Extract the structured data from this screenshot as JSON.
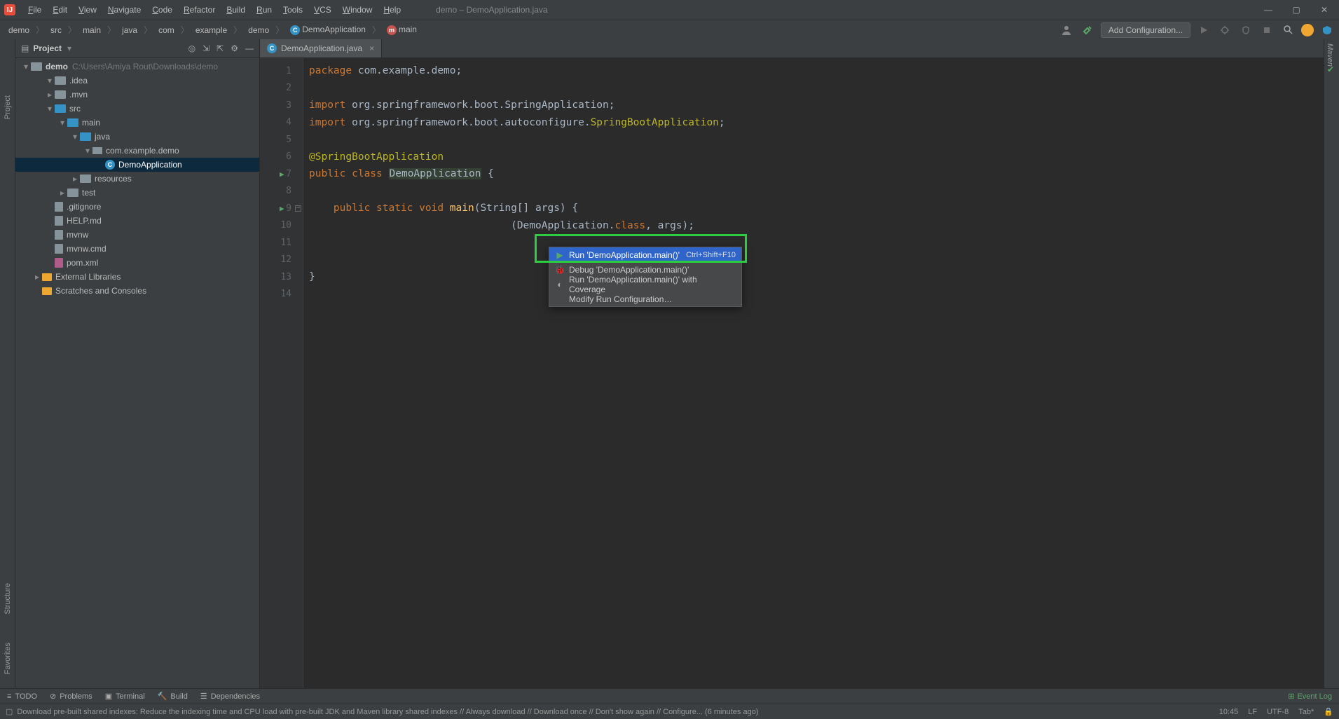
{
  "window": {
    "title": "demo – DemoApplication.java"
  },
  "menu": [
    "File",
    "Edit",
    "View",
    "Navigate",
    "Code",
    "Refactor",
    "Build",
    "Run",
    "Tools",
    "VCS",
    "Window",
    "Help"
  ],
  "breadcrumb": [
    "demo",
    "src",
    "main",
    "java",
    "com",
    "example",
    "demo",
    "DemoApplication",
    "main"
  ],
  "toolbar": {
    "config_label": "Add Configuration..."
  },
  "project_panel": {
    "title": "Project",
    "root": {
      "name": "demo",
      "path": "C:\\Users\\Amiya Rout\\Downloads\\demo"
    },
    "items": [
      {
        "depth": 1,
        "arrow": "down",
        "icon": "folder",
        "name": ".idea"
      },
      {
        "depth": 1,
        "arrow": "right",
        "icon": "folder",
        "name": ".mvn"
      },
      {
        "depth": 1,
        "arrow": "down",
        "icon": "folder-blue",
        "name": "src"
      },
      {
        "depth": 2,
        "arrow": "down",
        "icon": "folder-blue",
        "name": "main"
      },
      {
        "depth": 3,
        "arrow": "down",
        "icon": "folder-blue",
        "name": "java"
      },
      {
        "depth": 4,
        "arrow": "down",
        "icon": "pkg",
        "name": "com.example.demo"
      },
      {
        "depth": 5,
        "arrow": "",
        "icon": "java",
        "name": "DemoApplication",
        "selected": true
      },
      {
        "depth": 3,
        "arrow": "right",
        "icon": "folder",
        "name": "resources"
      },
      {
        "depth": 2,
        "arrow": "right",
        "icon": "folder",
        "name": "test"
      },
      {
        "depth": 1,
        "arrow": "",
        "icon": "file",
        "name": ".gitignore"
      },
      {
        "depth": 1,
        "arrow": "",
        "icon": "file",
        "name": "HELP.md"
      },
      {
        "depth": 1,
        "arrow": "",
        "icon": "file",
        "name": "mvnw"
      },
      {
        "depth": 1,
        "arrow": "",
        "icon": "file",
        "name": "mvnw.cmd"
      },
      {
        "depth": 1,
        "arrow": "",
        "icon": "file-m",
        "name": "pom.xml"
      },
      {
        "depth": 0,
        "arrow": "right",
        "icon": "lib",
        "name": "External Libraries"
      },
      {
        "depth": 0,
        "arrow": "",
        "icon": "lib",
        "name": "Scratches and Consoles"
      }
    ]
  },
  "tabs": [
    {
      "icon": "java",
      "label": "DemoApplication.java"
    }
  ],
  "code_lines": [
    {
      "n": 1,
      "tokens": [
        {
          "t": "package ",
          "c": "k"
        },
        {
          "t": "com.example.demo",
          "c": "pkg"
        },
        {
          "t": ";",
          "c": "s"
        }
      ]
    },
    {
      "n": 2,
      "tokens": []
    },
    {
      "n": 3,
      "tokens": [
        {
          "t": "import ",
          "c": "k"
        },
        {
          "t": "org.springframework.boot.SpringApplication",
          "c": "cls"
        },
        {
          "t": ";",
          "c": "s"
        }
      ]
    },
    {
      "n": 4,
      "tokens": [
        {
          "t": "import ",
          "c": "k"
        },
        {
          "t": "org.springframework.boot.autoconfigure.",
          "c": "cls"
        },
        {
          "t": "SpringBootApplication",
          "c": "an"
        },
        {
          "t": ";",
          "c": "s"
        }
      ]
    },
    {
      "n": 5,
      "tokens": []
    },
    {
      "n": 6,
      "tokens": [
        {
          "t": "@SpringBootApplication",
          "c": "an"
        }
      ]
    },
    {
      "n": 7,
      "run": true,
      "tokens": [
        {
          "t": "public class ",
          "c": "k"
        },
        {
          "t": "DemoApplication",
          "c": "c-name"
        },
        {
          "t": " {",
          "c": "s"
        }
      ]
    },
    {
      "n": 8,
      "tokens": []
    },
    {
      "n": 9,
      "run": true,
      "fold": true,
      "tokens": [
        {
          "t": "    ",
          "c": "s"
        },
        {
          "t": "public static void ",
          "c": "k"
        },
        {
          "t": "main",
          "c": "fn"
        },
        {
          "t": "(String[] args) {",
          "c": "s"
        }
      ]
    },
    {
      "n": 10,
      "tokens": [
        {
          "t": "                                 ",
          "c": "s"
        },
        {
          "t": "(DemoApplication.",
          "c": "s"
        },
        {
          "t": "class",
          "c": "k"
        },
        {
          "t": ", args);",
          "c": "s"
        }
      ]
    },
    {
      "n": 11,
      "tokens": []
    },
    {
      "n": 12,
      "tokens": []
    },
    {
      "n": 13,
      "tokens": [
        {
          "t": "}",
          "c": "s"
        }
      ]
    },
    {
      "n": 14,
      "tokens": []
    }
  ],
  "context_menu": [
    {
      "icon": "run",
      "label": "Run 'DemoApplication.main()'",
      "shortcut": "Ctrl+Shift+F10",
      "hl": true
    },
    {
      "icon": "debug",
      "label": "Debug 'DemoApplication.main()'",
      "shortcut": ""
    },
    {
      "icon": "cov",
      "label": "Run 'DemoApplication.main()' with Coverage",
      "shortcut": ""
    },
    {
      "icon": "",
      "label": "Modify Run Configuration…",
      "shortcut": ""
    }
  ],
  "left_rail": [
    "Project",
    "Structure",
    "Favorites"
  ],
  "right_rail_label": "Maven",
  "bottom_tools": [
    "TODO",
    "Problems",
    "Terminal",
    "Build",
    "Dependencies"
  ],
  "status": {
    "msg": "Download pre-built shared indexes: Reduce the indexing time and CPU load with pre-built JDK and Maven library shared indexes // Always download // Download once // Don't show again // Configure... (6 minutes ago)",
    "event_log": "Event Log",
    "time": "10:45",
    "lf": "LF",
    "enc": "UTF-8",
    "tab": "Tab*"
  }
}
